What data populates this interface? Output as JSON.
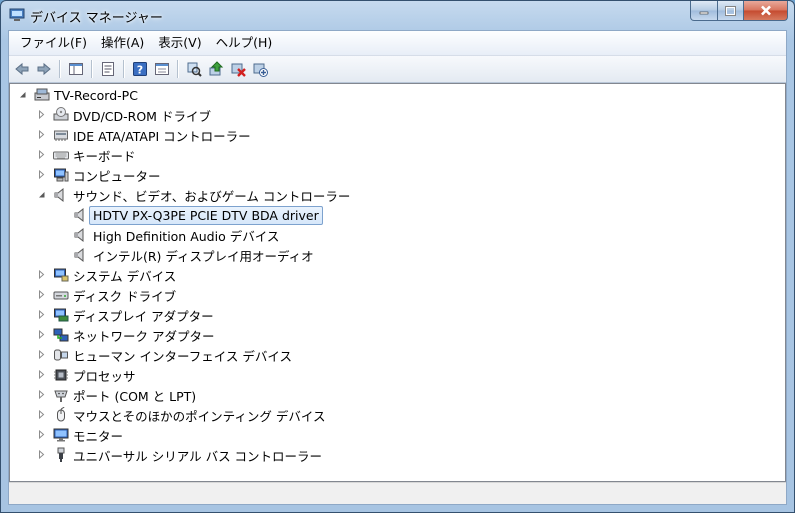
{
  "window": {
    "title": "デバイス マネージャー"
  },
  "menu": [
    "ファイル(F)",
    "操作(A)",
    "表示(V)",
    "ヘルプ(H)"
  ],
  "toolbar": [
    "back-icon",
    "forward-icon",
    "show-hide-tree-icon",
    "properties-icon",
    "help-icon",
    "view-icon",
    "scan-hardware-icon",
    "update-driver-icon",
    "uninstall-icon",
    "disable-device-icon"
  ],
  "tree": {
    "root": "TV-Record-PC",
    "categories": [
      {
        "label": "DVD/CD-ROM ドライブ",
        "icon": "dvd-drive-icon",
        "expanded": false
      },
      {
        "label": "IDE ATA/ATAPI コントローラー",
        "icon": "ide-controller-icon",
        "expanded": false
      },
      {
        "label": "キーボード",
        "icon": "keyboard-icon",
        "expanded": false
      },
      {
        "label": "コンピューター",
        "icon": "computer-icon",
        "expanded": false
      },
      {
        "label": "サウンド、ビデオ、およびゲーム コントローラー",
        "icon": "speaker-icon",
        "expanded": true,
        "children": [
          {
            "label": "HDTV PX-Q3PE PCIE DTV BDA driver",
            "icon": "speaker-icon",
            "selected": true
          },
          {
            "label": "High Definition Audio デバイス",
            "icon": "speaker-icon",
            "selected": false
          },
          {
            "label": "インテル(R) ディスプレイ用オーディオ",
            "icon": "speaker-icon",
            "selected": false
          }
        ]
      },
      {
        "label": "システム デバイス",
        "icon": "system-device-icon",
        "expanded": false
      },
      {
        "label": "ディスク ドライブ",
        "icon": "disk-drive-icon",
        "expanded": false
      },
      {
        "label": "ディスプレイ アダプター",
        "icon": "display-adapter-icon",
        "expanded": false
      },
      {
        "label": "ネットワーク アダプター",
        "icon": "network-adapter-icon",
        "expanded": false
      },
      {
        "label": "ヒューマン インターフェイス デバイス",
        "icon": "hid-icon",
        "expanded": false
      },
      {
        "label": "プロセッサ",
        "icon": "processor-icon",
        "expanded": false
      },
      {
        "label": "ポート (COM と LPT)",
        "icon": "port-icon",
        "expanded": false
      },
      {
        "label": "マウスとそのほかのポインティング デバイス",
        "icon": "mouse-icon",
        "expanded": false
      },
      {
        "label": "モニター",
        "icon": "monitor-icon",
        "expanded": false
      },
      {
        "label": "ユニバーサル シリアル バス コントローラー",
        "icon": "usb-icon",
        "expanded": false
      }
    ]
  },
  "colors": {
    "selection_border": "#7da2ce",
    "selection_fill": "#d6e7fa",
    "frame": "#a9c6e4"
  }
}
